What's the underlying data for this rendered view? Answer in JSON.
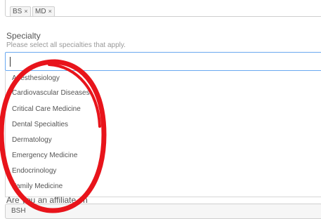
{
  "tags": {
    "items": [
      {
        "label": "BS",
        "remove": "×"
      },
      {
        "label": "MD",
        "remove": "×"
      }
    ]
  },
  "specialty": {
    "title": "Specialty",
    "help": "Please select all specialties that apply.",
    "input_value": "",
    "options": [
      "Anesthesiology",
      "Cardiovascular Diseases",
      "Critical Care Medicine",
      "Dental Specialties",
      "Dermatology",
      "Emergency Medicine",
      "Endocrinology",
      "Family Medicine"
    ]
  },
  "affiliation": {
    "label": "Are you an affiliate on",
    "value": "BSH"
  },
  "annotation": {
    "color": "#e8141b",
    "icon": "red-oval-highlight"
  }
}
